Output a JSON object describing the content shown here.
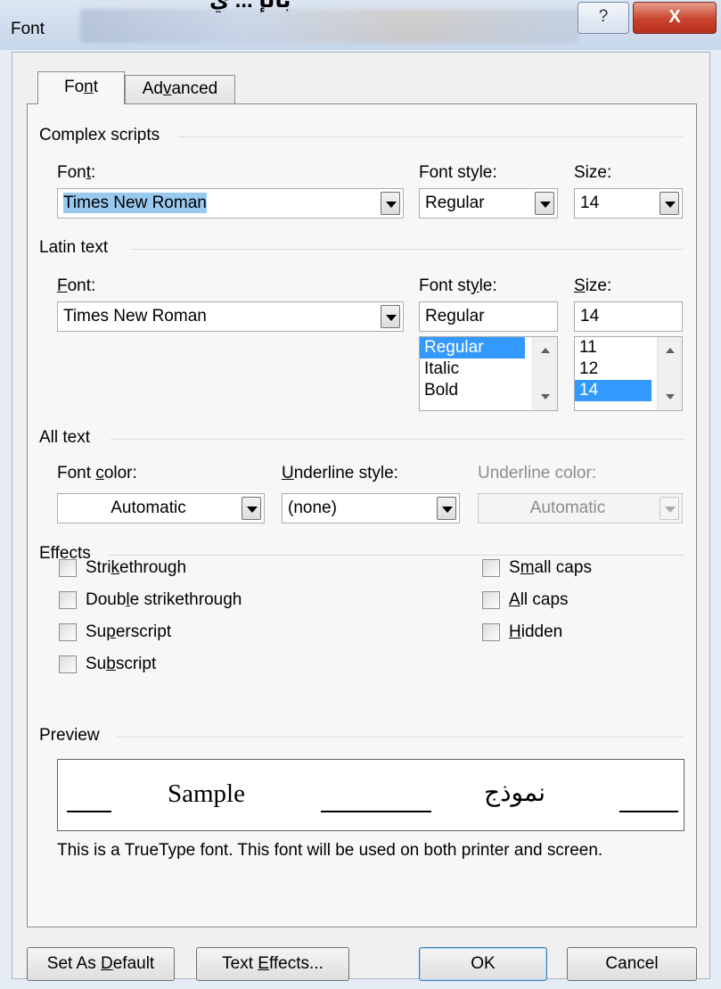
{
  "window": {
    "title": "Font",
    "top_text": "بالإ ... ي",
    "help_label": "?",
    "close_label": "X"
  },
  "tabs": [
    {
      "label": "Font",
      "accel": "n",
      "selected": true
    },
    {
      "label": "Advanced",
      "accel": "v",
      "selected": false
    }
  ],
  "complex_scripts": {
    "group_label": "Complex scripts",
    "font_label": "Font:",
    "font_value": "Times New Roman",
    "style_label": "Font style:",
    "style_value": "Regular",
    "size_label": "Size:",
    "size_value": "14"
  },
  "latin_text": {
    "group_label": "Latin text",
    "font_label": "Font:",
    "font_value": "Times New Roman",
    "style_label": "Font style:",
    "style_value": "Regular",
    "style_options": [
      "Regular",
      "Italic",
      "Bold"
    ],
    "style_selected": "Regular",
    "size_label": "Size:",
    "size_value": "14",
    "size_options": [
      "11",
      "12",
      "14"
    ],
    "size_selected": "14"
  },
  "all_text": {
    "group_label": "All text",
    "color_label": "Font color:",
    "color_value": "Automatic",
    "underline_label": "Underline style:",
    "underline_value": "(none)",
    "underline_color_label": "Underline color:",
    "underline_color_value": "Automatic"
  },
  "effects": {
    "group_label": "Effects",
    "left": [
      "Strikethrough",
      "Double strikethrough",
      "Superscript",
      "Subscript"
    ],
    "right": [
      "Small caps",
      "All caps",
      "Hidden"
    ]
  },
  "preview": {
    "group_label": "Preview",
    "sample": "Sample",
    "arabic_sample": "نموذج",
    "note": "This is a TrueType font. This font will be used on both printer and screen."
  },
  "buttons": {
    "set_default": "Set As Default",
    "text_effects": "Text Effects...",
    "ok": "OK",
    "cancel": "Cancel"
  },
  "colors": {
    "selection_highlight": "#3399ff",
    "combo_text_highlight": "#99c9ef",
    "close_button": "#c9432e"
  }
}
